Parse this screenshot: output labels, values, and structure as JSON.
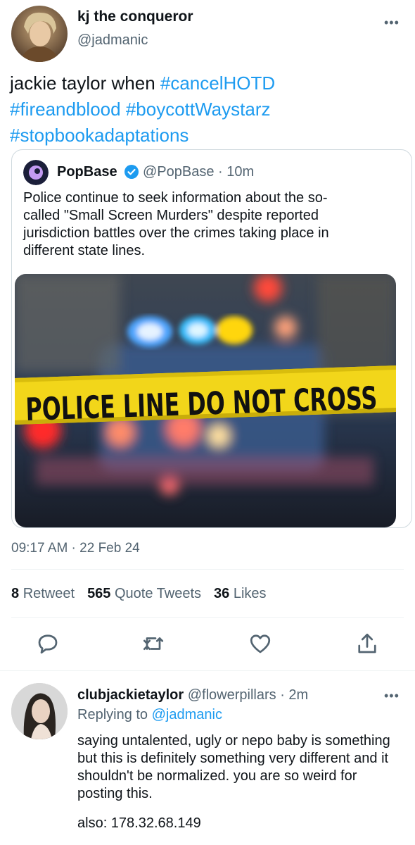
{
  "tweet": {
    "author_name": "kj the conqueror",
    "author_handle": "@jadmanic",
    "more_icon": "more-horizontal-icon",
    "text_plain": "jackie taylor when ",
    "hashtags": [
      "#cancelHOTD",
      "#fireandblood",
      "#boycottWaystarz",
      "#stopbookadaptations"
    ],
    "timestamp": "09:17 AM · 22 Feb 24"
  },
  "quote": {
    "name": "PopBase",
    "verified_icon": "verified-badge-icon",
    "handle_time": "@PopBase · 10m",
    "text": "Police continue to seek information about the so-called \"Small Screen Murders\" despite reported jurisdiction battles over the crimes taking place in different state lines.",
    "image_tape_text": "POLICE LINE DO NOT CROSS"
  },
  "stats": {
    "retweets_count": "8",
    "retweets_label": "Retweet",
    "quotes_count": "565",
    "quotes_label": "Quote Tweets",
    "likes_count": "36",
    "likes_label": "Likes"
  },
  "actions": [
    "reply-icon",
    "retweet-icon",
    "like-icon",
    "share-icon"
  ],
  "reply": {
    "author_name": "clubjackietaylor",
    "handle_time": "@flowerpillars · 2m",
    "replying_prefix": "Replying to ",
    "replying_to": "@jadmanic",
    "text": "saying untalented, ugly or nepo baby is something but this is definitely something very different and it shouldn't be normalized. you are so weird for posting this.",
    "also": "also: 178.32.68.149"
  },
  "colors": {
    "link": "#1d9bf0",
    "muted": "#536471",
    "text": "#0f1419",
    "divider": "#eff3f4",
    "tape_yellow": "#f2d61a"
  }
}
